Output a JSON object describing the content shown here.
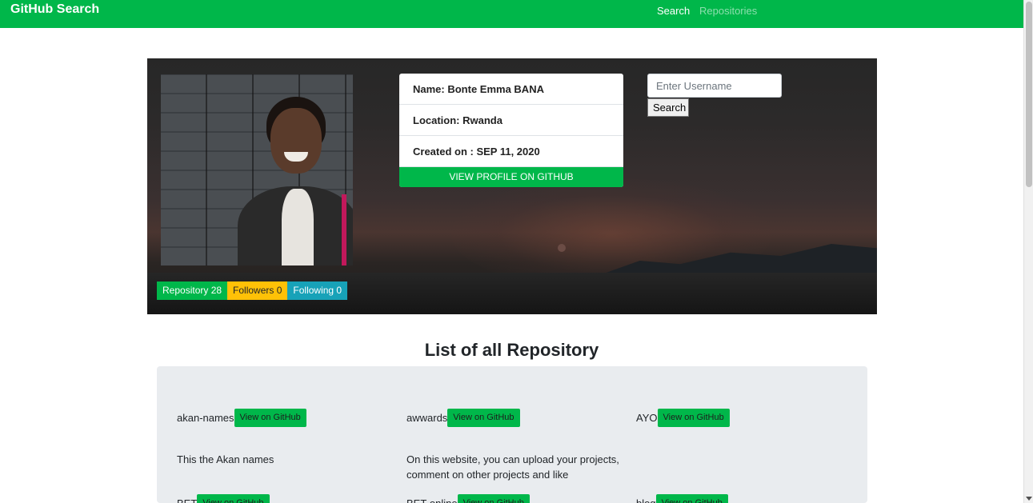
{
  "navbar": {
    "brand": "GitHub Search",
    "links": {
      "search": "Search",
      "repositories": "Repositories"
    }
  },
  "profile": {
    "name_line": "Name: Bonte Emma BANA",
    "location_line": "Location: Rwanda",
    "created_line": "Created on : SEP 11, 2020",
    "view_button": "VIEW PROFILE ON GITHUB"
  },
  "search": {
    "placeholder": "Enter Username",
    "button": "Search"
  },
  "badges": {
    "repository": "Repository 28",
    "followers": "Followers 0",
    "following": "Following 0"
  },
  "repo_list": {
    "title": "List of all Repository",
    "button_label": "View on GitHub",
    "items": [
      {
        "name": "akan-names",
        "description": "This the Akan names"
      },
      {
        "name": "awwards",
        "description": "On this website, you can upload your projects, comment on other projects and like"
      },
      {
        "name": "AYO",
        "description": ""
      },
      {
        "name": "BET",
        "description": ""
      },
      {
        "name": "BET-online",
        "description": ""
      },
      {
        "name": "blog",
        "description": ""
      }
    ]
  },
  "colors": {
    "accent": "#00b74a",
    "warning": "#ffc107",
    "info": "#17a2b8"
  }
}
